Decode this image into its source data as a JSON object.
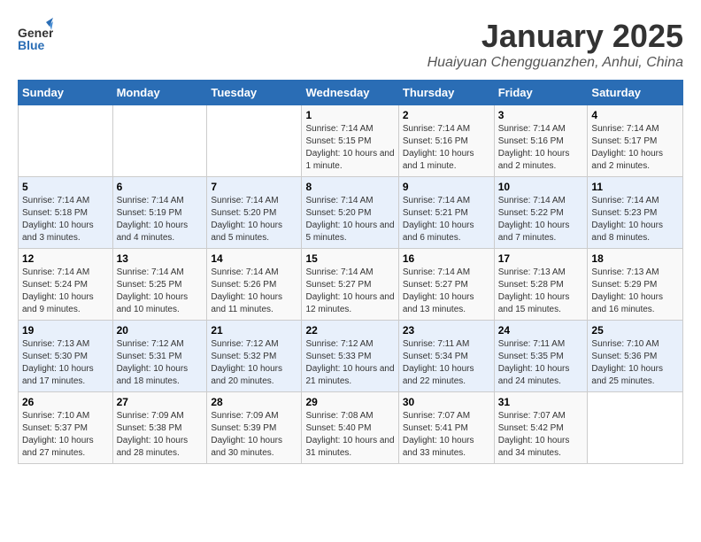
{
  "header": {
    "logo_general": "General",
    "logo_blue": "Blue",
    "month_title": "January 2025",
    "subtitle": "Huaiyuan Chengguanzhen, Anhui, China"
  },
  "weekdays": [
    "Sunday",
    "Monday",
    "Tuesday",
    "Wednesday",
    "Thursday",
    "Friday",
    "Saturday"
  ],
  "weeks": [
    [
      {
        "day": "",
        "sunrise": "",
        "sunset": "",
        "daylight": ""
      },
      {
        "day": "",
        "sunrise": "",
        "sunset": "",
        "daylight": ""
      },
      {
        "day": "",
        "sunrise": "",
        "sunset": "",
        "daylight": ""
      },
      {
        "day": "1",
        "sunrise": "Sunrise: 7:14 AM",
        "sunset": "Sunset: 5:15 PM",
        "daylight": "Daylight: 10 hours and 1 minute."
      },
      {
        "day": "2",
        "sunrise": "Sunrise: 7:14 AM",
        "sunset": "Sunset: 5:16 PM",
        "daylight": "Daylight: 10 hours and 1 minute."
      },
      {
        "day": "3",
        "sunrise": "Sunrise: 7:14 AM",
        "sunset": "Sunset: 5:16 PM",
        "daylight": "Daylight: 10 hours and 2 minutes."
      },
      {
        "day": "4",
        "sunrise": "Sunrise: 7:14 AM",
        "sunset": "Sunset: 5:17 PM",
        "daylight": "Daylight: 10 hours and 2 minutes."
      }
    ],
    [
      {
        "day": "5",
        "sunrise": "Sunrise: 7:14 AM",
        "sunset": "Sunset: 5:18 PM",
        "daylight": "Daylight: 10 hours and 3 minutes."
      },
      {
        "day": "6",
        "sunrise": "Sunrise: 7:14 AM",
        "sunset": "Sunset: 5:19 PM",
        "daylight": "Daylight: 10 hours and 4 minutes."
      },
      {
        "day": "7",
        "sunrise": "Sunrise: 7:14 AM",
        "sunset": "Sunset: 5:20 PM",
        "daylight": "Daylight: 10 hours and 5 minutes."
      },
      {
        "day": "8",
        "sunrise": "Sunrise: 7:14 AM",
        "sunset": "Sunset: 5:20 PM",
        "daylight": "Daylight: 10 hours and 5 minutes."
      },
      {
        "day": "9",
        "sunrise": "Sunrise: 7:14 AM",
        "sunset": "Sunset: 5:21 PM",
        "daylight": "Daylight: 10 hours and 6 minutes."
      },
      {
        "day": "10",
        "sunrise": "Sunrise: 7:14 AM",
        "sunset": "Sunset: 5:22 PM",
        "daylight": "Daylight: 10 hours and 7 minutes."
      },
      {
        "day": "11",
        "sunrise": "Sunrise: 7:14 AM",
        "sunset": "Sunset: 5:23 PM",
        "daylight": "Daylight: 10 hours and 8 minutes."
      }
    ],
    [
      {
        "day": "12",
        "sunrise": "Sunrise: 7:14 AM",
        "sunset": "Sunset: 5:24 PM",
        "daylight": "Daylight: 10 hours and 9 minutes."
      },
      {
        "day": "13",
        "sunrise": "Sunrise: 7:14 AM",
        "sunset": "Sunset: 5:25 PM",
        "daylight": "Daylight: 10 hours and 10 minutes."
      },
      {
        "day": "14",
        "sunrise": "Sunrise: 7:14 AM",
        "sunset": "Sunset: 5:26 PM",
        "daylight": "Daylight: 10 hours and 11 minutes."
      },
      {
        "day": "15",
        "sunrise": "Sunrise: 7:14 AM",
        "sunset": "Sunset: 5:27 PM",
        "daylight": "Daylight: 10 hours and 12 minutes."
      },
      {
        "day": "16",
        "sunrise": "Sunrise: 7:14 AM",
        "sunset": "Sunset: 5:27 PM",
        "daylight": "Daylight: 10 hours and 13 minutes."
      },
      {
        "day": "17",
        "sunrise": "Sunrise: 7:13 AM",
        "sunset": "Sunset: 5:28 PM",
        "daylight": "Daylight: 10 hours and 15 minutes."
      },
      {
        "day": "18",
        "sunrise": "Sunrise: 7:13 AM",
        "sunset": "Sunset: 5:29 PM",
        "daylight": "Daylight: 10 hours and 16 minutes."
      }
    ],
    [
      {
        "day": "19",
        "sunrise": "Sunrise: 7:13 AM",
        "sunset": "Sunset: 5:30 PM",
        "daylight": "Daylight: 10 hours and 17 minutes."
      },
      {
        "day": "20",
        "sunrise": "Sunrise: 7:12 AM",
        "sunset": "Sunset: 5:31 PM",
        "daylight": "Daylight: 10 hours and 18 minutes."
      },
      {
        "day": "21",
        "sunrise": "Sunrise: 7:12 AM",
        "sunset": "Sunset: 5:32 PM",
        "daylight": "Daylight: 10 hours and 20 minutes."
      },
      {
        "day": "22",
        "sunrise": "Sunrise: 7:12 AM",
        "sunset": "Sunset: 5:33 PM",
        "daylight": "Daylight: 10 hours and 21 minutes."
      },
      {
        "day": "23",
        "sunrise": "Sunrise: 7:11 AM",
        "sunset": "Sunset: 5:34 PM",
        "daylight": "Daylight: 10 hours and 22 minutes."
      },
      {
        "day": "24",
        "sunrise": "Sunrise: 7:11 AM",
        "sunset": "Sunset: 5:35 PM",
        "daylight": "Daylight: 10 hours and 24 minutes."
      },
      {
        "day": "25",
        "sunrise": "Sunrise: 7:10 AM",
        "sunset": "Sunset: 5:36 PM",
        "daylight": "Daylight: 10 hours and 25 minutes."
      }
    ],
    [
      {
        "day": "26",
        "sunrise": "Sunrise: 7:10 AM",
        "sunset": "Sunset: 5:37 PM",
        "daylight": "Daylight: 10 hours and 27 minutes."
      },
      {
        "day": "27",
        "sunrise": "Sunrise: 7:09 AM",
        "sunset": "Sunset: 5:38 PM",
        "daylight": "Daylight: 10 hours and 28 minutes."
      },
      {
        "day": "28",
        "sunrise": "Sunrise: 7:09 AM",
        "sunset": "Sunset: 5:39 PM",
        "daylight": "Daylight: 10 hours and 30 minutes."
      },
      {
        "day": "29",
        "sunrise": "Sunrise: 7:08 AM",
        "sunset": "Sunset: 5:40 PM",
        "daylight": "Daylight: 10 hours and 31 minutes."
      },
      {
        "day": "30",
        "sunrise": "Sunrise: 7:07 AM",
        "sunset": "Sunset: 5:41 PM",
        "daylight": "Daylight: 10 hours and 33 minutes."
      },
      {
        "day": "31",
        "sunrise": "Sunrise: 7:07 AM",
        "sunset": "Sunset: 5:42 PM",
        "daylight": "Daylight: 10 hours and 34 minutes."
      },
      {
        "day": "",
        "sunrise": "",
        "sunset": "",
        "daylight": ""
      }
    ]
  ]
}
